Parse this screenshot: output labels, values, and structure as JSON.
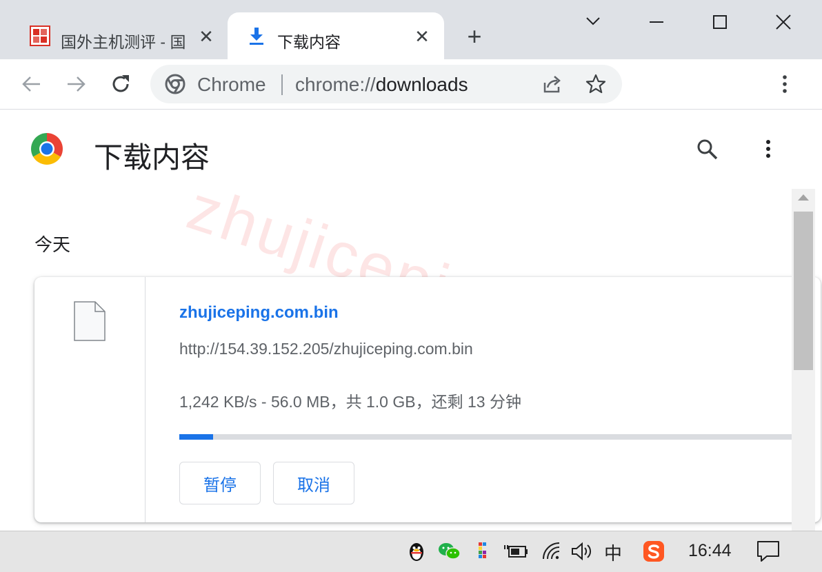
{
  "tabs": [
    {
      "title": "国外主机测评 - 国",
      "active": false,
      "favicon": "site-logo-icon"
    },
    {
      "title": "下载内容",
      "active": true,
      "favicon": "download-icon"
    }
  ],
  "toolbar": {
    "omnibox_label": "Chrome",
    "url_scheme": "chrome://",
    "url_path": "downloads"
  },
  "page": {
    "heading": "下载内容",
    "watermark": "zhujiceping.com"
  },
  "downloads": {
    "date_group": "今天",
    "items": [
      {
        "file_name": "zhujiceping.com.bin",
        "url": "http://154.39.152.205/zhujiceping.com.bin",
        "status": "1,242 KB/s - 56.0 MB，共 1.0 GB，还剩 13 分钟",
        "progress_percent": 5.5,
        "pause_label": "暂停",
        "cancel_label": "取消"
      }
    ]
  },
  "taskbar": {
    "ime": "中",
    "clock": "16:44"
  },
  "colors": {
    "accent": "#1a73e8",
    "tabstrip": "#dee1e6",
    "omnibox": "#f1f3f4",
    "watermark": "#f05050"
  }
}
